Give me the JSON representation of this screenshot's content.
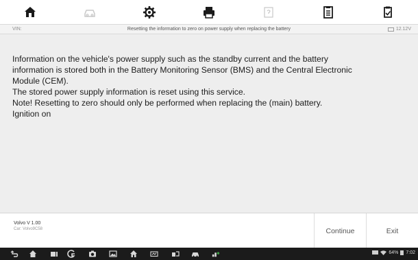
{
  "toolbar": {
    "buttons": [
      {
        "icon": "home-icon",
        "enabled": true
      },
      {
        "icon": "vehicle-swap-icon",
        "enabled": false
      },
      {
        "icon": "settings-gear-icon",
        "enabled": true
      },
      {
        "icon": "print-icon",
        "enabled": true
      },
      {
        "icon": "help-icon",
        "enabled": false
      },
      {
        "icon": "data-logging-icon",
        "enabled": true
      },
      {
        "icon": "screenshot-save-icon",
        "enabled": true
      }
    ]
  },
  "subtitle": {
    "vin_label": "VIN:",
    "title": "Resetting the information to zero on power supply when replacing the battery",
    "voltage": "12.12V"
  },
  "message": {
    "lines": [
      "Information on the vehicle's power supply such as the standby current and the battery",
      "information is stored both in the Battery Monitoring Sensor (BMS) and the Central Electronic",
      "Module (CEM).",
      "The stored power supply information is reset using this service.",
      "Note! Resetting to zero should only be performed when replacing the (main) battery.",
      "Ignition on"
    ]
  },
  "footer": {
    "vehicle": "Volvo V 1.00",
    "vehicle_sub": "Car: Volvo9C58",
    "continue_label": "Continue",
    "exit_label": "Exit"
  },
  "navbar": {
    "status_text": "64%",
    "clock": "7:02"
  },
  "colors": {
    "content_bg": "#eeeeee",
    "subtitle_bg": "#f3f3f3",
    "navbar_bg": "#1b1b1b"
  }
}
